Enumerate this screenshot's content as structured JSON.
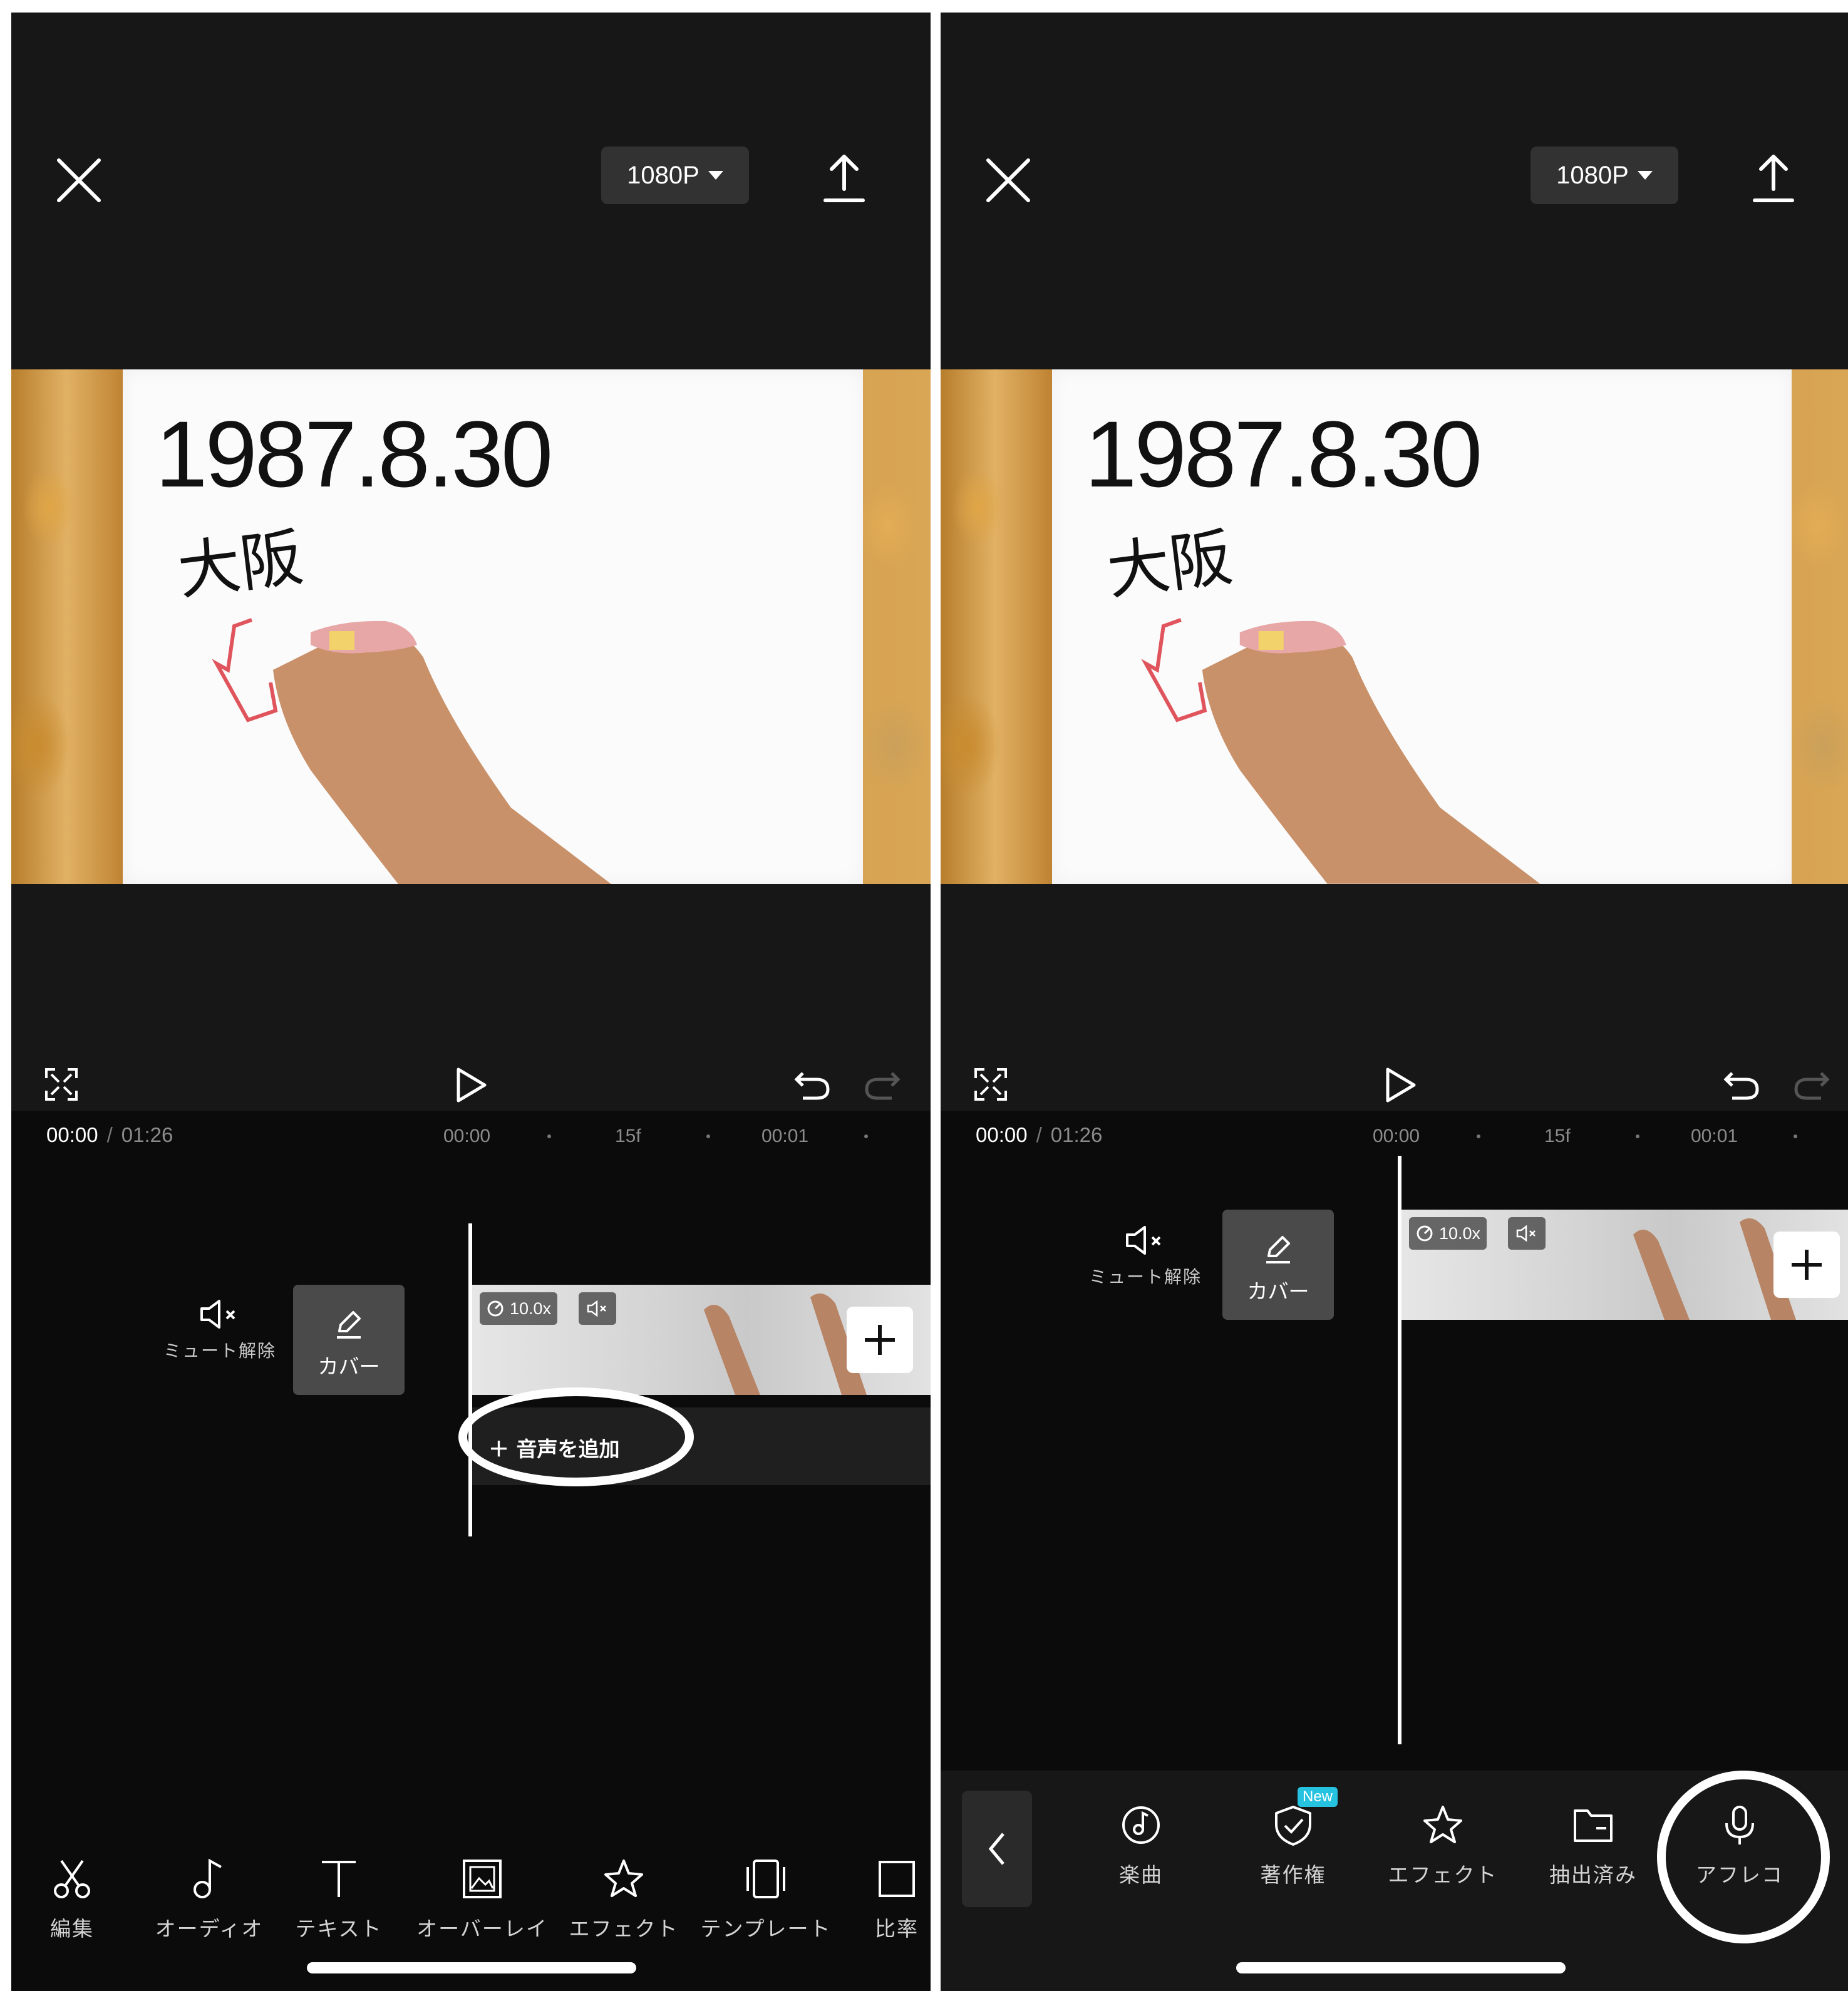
{
  "left_screen": {
    "resolution": "1080P",
    "board_date": "1987.8.30",
    "board_city": "大阪",
    "time_current": "00:00",
    "time_separator": "/",
    "time_total": "01:26",
    "ruler": [
      "00:00",
      "15f",
      "00:01"
    ],
    "mute_label": "ミュート解除",
    "cover_label": "カバー",
    "speed": "10.0x",
    "add_audio": "音声を追加",
    "toolbar": [
      {
        "icon": "scissors-icon",
        "label": "編集"
      },
      {
        "icon": "music-note-icon",
        "label": "オーディオ"
      },
      {
        "icon": "text-icon",
        "label": "テキスト"
      },
      {
        "icon": "overlay-icon",
        "label": "オーバーレイ"
      },
      {
        "icon": "effect-star-icon",
        "label": "エフェクト"
      },
      {
        "icon": "template-icon",
        "label": "テンプレート"
      },
      {
        "icon": "ratio-icon",
        "label": "比率"
      }
    ]
  },
  "right_screen": {
    "resolution": "1080P",
    "board_date": "1987.8.30",
    "board_city": "大阪",
    "time_current": "00:00",
    "time_separator": "/",
    "time_total": "01:26",
    "ruler": [
      "00:00",
      "15f",
      "00:01"
    ],
    "mute_label": "ミュート解除",
    "cover_label": "カバー",
    "speed": "10.0x",
    "new_badge": "New",
    "toolbar": [
      {
        "icon": "music-disc-icon",
        "label": "楽曲"
      },
      {
        "icon": "shield-check-icon",
        "label": "著作権"
      },
      {
        "icon": "effect-star-icon",
        "label": "エフェクト"
      },
      {
        "icon": "folder-icon",
        "label": "抽出済み"
      },
      {
        "icon": "microphone-icon",
        "label": "アフレコ"
      }
    ]
  },
  "colors": {
    "background": "#0b0b0b",
    "topbar": "#171717",
    "button_bg": "#323232",
    "new_badge": "#25c3e0",
    "highlight_ring": "#ffffff"
  }
}
